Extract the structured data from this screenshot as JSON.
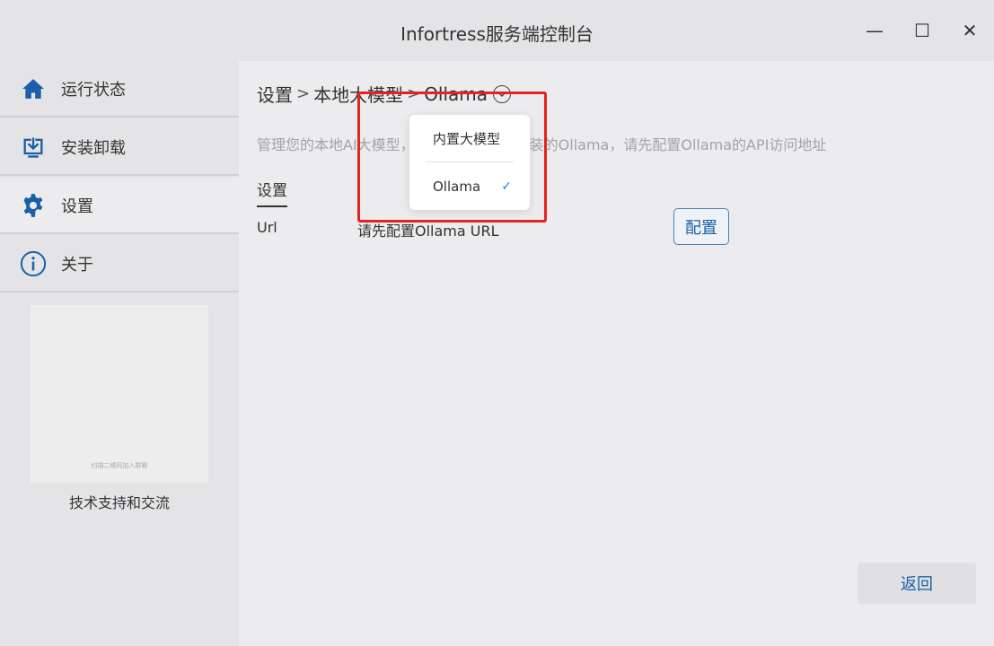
{
  "window": {
    "title": "Infortress服务端控制台",
    "minimize": "—",
    "maximize": "☐",
    "close": "✕"
  },
  "sidebar": {
    "items": [
      {
        "label": "运行状态",
        "icon": "home-icon"
      },
      {
        "label": "安装卸载",
        "icon": "install-icon"
      },
      {
        "label": "设置",
        "icon": "gear-icon"
      },
      {
        "label": "关于",
        "icon": "info-icon"
      }
    ],
    "active_index": 2,
    "qr_caption": "扫描二维码加入群聊",
    "support_text": "技术支持和交流"
  },
  "breadcrumb": {
    "items": [
      "设置",
      "本地大模型",
      "Ollama"
    ],
    "separator": ">"
  },
  "main": {
    "description": "管理您的本地AI大模型，如果您使用单独安装的Ollama，请先配置Ollama的API访问地址",
    "section_title": "设置",
    "url_label": "Url",
    "url_value": "请先配置Ollama URL",
    "config_button": "配置",
    "back_button": "返回"
  },
  "dropdown": {
    "options": [
      "内置大模型",
      "Ollama"
    ],
    "selected": "Ollama",
    "check_mark": "✓"
  },
  "colors": {
    "accent": "#1a5fa8",
    "highlight_border": "#e82222",
    "check": "#2a7fd4"
  }
}
